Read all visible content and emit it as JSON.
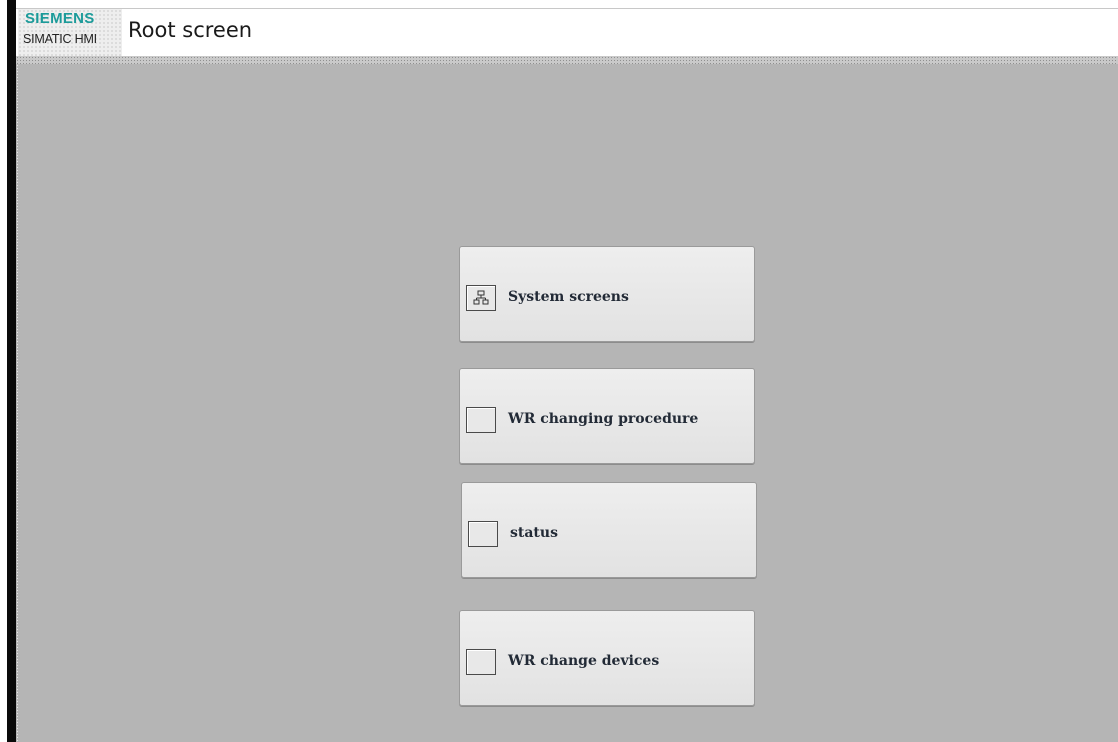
{
  "header": {
    "brand": "SIEMENS",
    "product": "SIMATIC HMI",
    "title": "Root screen",
    "brand_color": "#1c9b9a"
  },
  "canvas": {
    "background": "#b5b5b5"
  },
  "buttons": [
    {
      "label": "System screens",
      "icon": "system-screens-icon"
    },
    {
      "label": "WR changing procedure",
      "icon": "blank-icon"
    },
    {
      "label": "status",
      "icon": "blank-icon"
    },
    {
      "label": "WR change devices",
      "icon": "blank-icon"
    }
  ]
}
